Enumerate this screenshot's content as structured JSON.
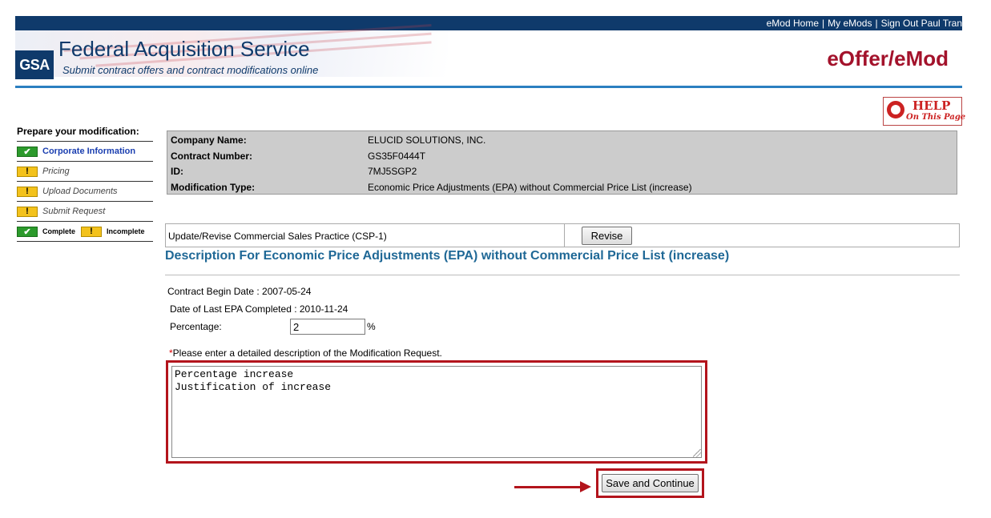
{
  "top_nav": {
    "links": [
      "eMod Home",
      "My eMods",
      "Sign Out Paul Tran"
    ],
    "separator": "|"
  },
  "header": {
    "logo_text": "GSA",
    "title": "Federal Acquisition Service",
    "subtitle": "Submit contract offers and contract modifications online",
    "app_name": "eOffer/eMod"
  },
  "help": {
    "title": "HELP",
    "subtitle": "On This Page"
  },
  "sidebar": {
    "title": "Prepare your modification:",
    "items": [
      {
        "label": "Corporate Information",
        "status": "complete",
        "icon": "check-icon"
      },
      {
        "label": "Pricing",
        "status": "incomplete",
        "icon": "exclamation-icon"
      },
      {
        "label": "Upload Documents",
        "status": "incomplete",
        "icon": "exclamation-icon"
      },
      {
        "label": "Submit Request",
        "status": "incomplete",
        "icon": "exclamation-icon"
      }
    ],
    "legend": {
      "complete": "Complete",
      "incomplete": "Incomplete"
    }
  },
  "info": {
    "company_label": "Company Name:",
    "company": "ELUCID SOLUTIONS, INC.",
    "contract_label": "Contract Number:",
    "contract": "GS35F0444T",
    "id_label": "ID:",
    "id": "7MJ5SGP2",
    "modtype_label": "Modification Type:",
    "modtype": "Economic Price Adjustments (EPA) without Commercial Price List (increase)"
  },
  "csp": {
    "label": "Update/Revise Commercial Sales Practice (CSP-1)",
    "button": "Revise"
  },
  "description": {
    "title": "Description For Economic Price Adjustments (EPA) without Commercial Price List (increase)",
    "begin_date": "Contract Begin Date : 2007-05-24",
    "last_epa": "Date of Last EPA Completed : 2010-11-24",
    "percentage_label": "Percentage:",
    "percentage_value": "2",
    "percent_sign": "%",
    "instruction_asterisk": "*",
    "instruction": "Please enter a detailed description of the Modification Request.",
    "textarea_value": "Percentage increase\nJustification of increase",
    "save_button": "Save and Continue"
  },
  "colors": {
    "accent_red": "#b3141c",
    "nav_blue": "#0f3a6b",
    "title_blue": "#1f6896"
  }
}
